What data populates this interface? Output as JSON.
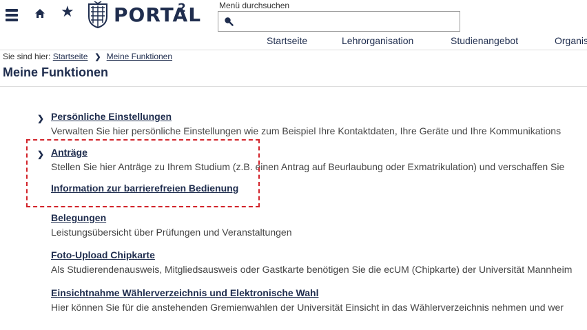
{
  "header": {
    "logo_text": "PORTAL",
    "logo_superscript": "2",
    "search": {
      "label": "Menü durchsuchen",
      "value": "",
      "placeholder": ""
    },
    "nav": [
      "Startseite",
      "Lehrorganisation",
      "Studienangebot",
      "Organis"
    ]
  },
  "breadcrumb": {
    "prefix": "Sie sind hier:",
    "items": [
      "Startseite",
      "Meine Funktionen"
    ]
  },
  "page": {
    "title": "Meine Funktionen"
  },
  "entries": [
    {
      "link": "Persönliche Einstellungen",
      "desc": "Verwalten Sie hier persönliche Einstellungen wie zum Beispiel Ihre Kontaktdaten, Ihre Geräte und Ihre Kommunikations"
    },
    {
      "link": "Anträge",
      "desc": "Stellen Sie hier Anträge zu Ihrem Studium (z.B. einen Antrag auf Beurlaubung oder Exmatrikulation) und verschaffen Sie"
    },
    {
      "link": "Information zur barrierefreien Bedienung",
      "desc": ""
    },
    {
      "link": "Belegungen",
      "desc": "Leistungsübersicht über Prüfungen und Veranstaltungen"
    },
    {
      "link": "Foto-Upload Chipkarte",
      "desc": "Als Studierendenausweis, Mitgliedsausweis oder Gastkarte benötigen Sie die ecUM (Chipkarte) der Universität Mannheim"
    },
    {
      "link": "Einsichtnahme Wählerverzeichnis und Elektronische Wahl",
      "desc": "Hier können Sie für die anstehenden Gremienwahlen der Universität Einsicht in das Wählerverzeichnis nehmen und wer"
    }
  ],
  "colors": {
    "brand": "#1f2d4e",
    "highlight": "#d2232a"
  }
}
